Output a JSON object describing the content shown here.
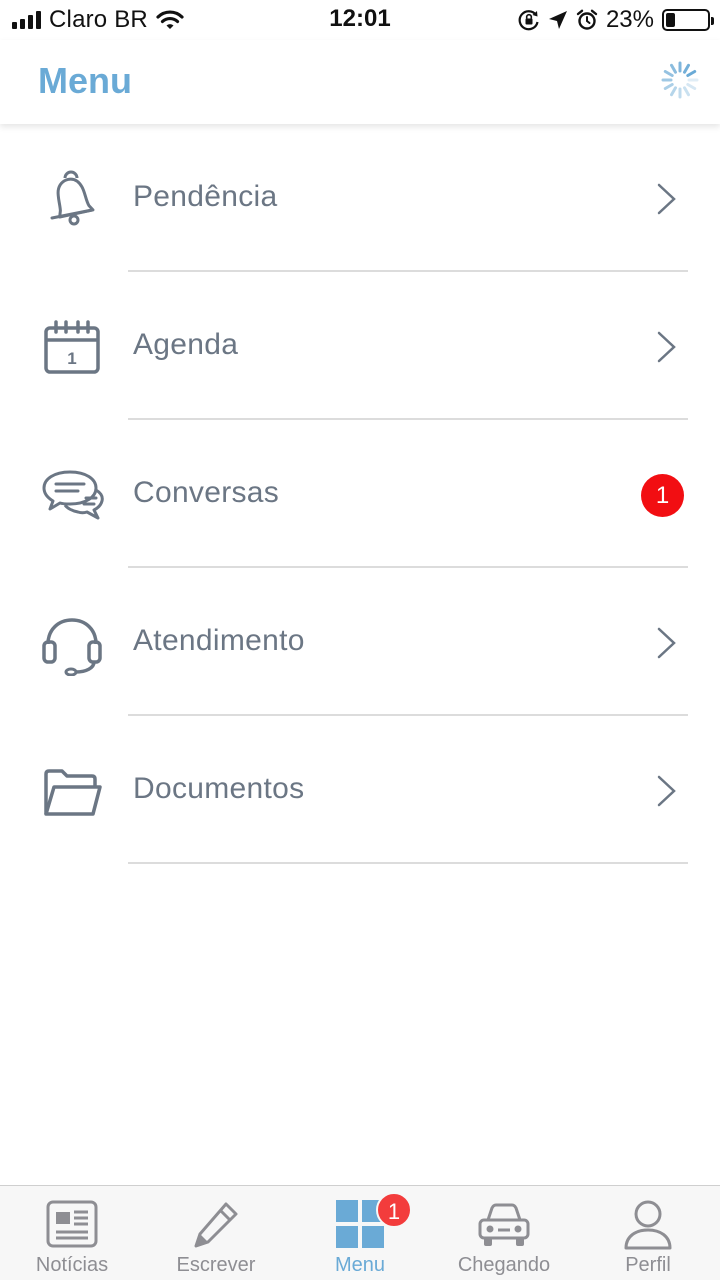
{
  "status_bar": {
    "carrier": "Claro BR",
    "time": "12:01",
    "battery": "23%",
    "battery_level": 0.23
  },
  "header": {
    "title": "Menu",
    "title_color": "#6aaad6"
  },
  "menu": {
    "items": [
      {
        "label": "Pendência",
        "icon": "bell-icon"
      },
      {
        "label": "Agenda",
        "icon": "calendar-icon",
        "icon_text": "1"
      },
      {
        "label": "Conversas",
        "icon": "chat-bubbles-icon",
        "badge": "1"
      },
      {
        "label": "Atendimento",
        "icon": "headset-icon"
      },
      {
        "label": "Documentos",
        "icon": "folder-icon"
      }
    ]
  },
  "tab_bar": {
    "tabs": [
      {
        "label": "Notícias",
        "icon": "newspaper-icon"
      },
      {
        "label": "Escrever",
        "icon": "pencil-icon"
      },
      {
        "label": "Menu",
        "icon": "grid-icon",
        "badge": "1",
        "active": true
      },
      {
        "label": "Chegando",
        "icon": "car-icon"
      },
      {
        "label": "Perfil",
        "icon": "person-icon"
      }
    ]
  },
  "colors": {
    "accent": "#6aaad6",
    "badge": "#f20e12",
    "icon": "#6b7684"
  }
}
